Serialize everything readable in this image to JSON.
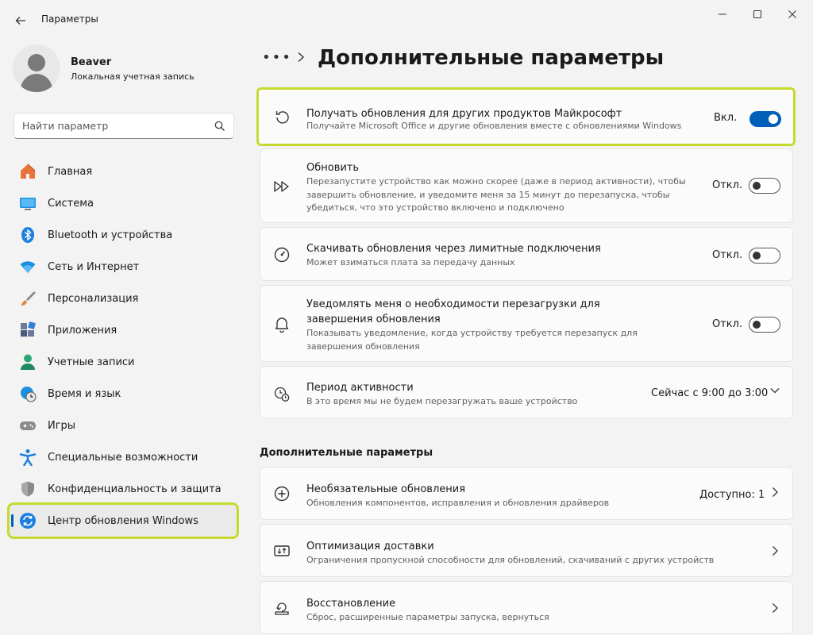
{
  "window": {
    "title": "Параметры",
    "back_icon": "back-arrow-icon",
    "minimize_icon": "minimize-icon",
    "maximize_icon": "maximize-icon",
    "close_icon": "close-icon"
  },
  "profile": {
    "name": "Beaver",
    "account_type": "Локальная учетная запись"
  },
  "search": {
    "placeholder": "Найти параметр"
  },
  "sidebar": {
    "items": [
      {
        "label": "Главная",
        "icon": "home-icon",
        "color": "#e8733a"
      },
      {
        "label": "Система",
        "icon": "monitor-icon",
        "color": "#1d8fe0"
      },
      {
        "label": "Bluetooth и устройства",
        "icon": "bluetooth-icon",
        "color": "#1d7fe0"
      },
      {
        "label": "Сеть и Интернет",
        "icon": "wifi-icon",
        "color": "#1d8fe0"
      },
      {
        "label": "Персонализация",
        "icon": "brush-icon",
        "color": "#e08a3a"
      },
      {
        "label": "Приложения",
        "icon": "apps-icon",
        "color": "#4a5a7a"
      },
      {
        "label": "Учетные записи",
        "icon": "account-icon",
        "color": "#2aa876"
      },
      {
        "label": "Время и язык",
        "icon": "globe-clock-icon",
        "color": "#1d8fe0"
      },
      {
        "label": "Игры",
        "icon": "gamepad-icon",
        "color": "#8a8a8a"
      },
      {
        "label": "Специальные возможности",
        "icon": "accessibility-icon",
        "color": "#1d7fe0"
      },
      {
        "label": "Конфиденциальность и защита",
        "icon": "shield-icon",
        "color": "#8a8a8a"
      },
      {
        "label": "Центр обновления Windows",
        "icon": "windows-update-icon",
        "color": "#1d7fe0"
      }
    ],
    "active_index": 11
  },
  "breadcrumb": {
    "overflow": "•••",
    "title": "Дополнительные параметры"
  },
  "settings": [
    {
      "title": "Получать обновления для других продуктов Майкрософт",
      "desc": "Получайте Microsoft Office и другие обновления вместе с обновлениями Windows",
      "state": "Вкл.",
      "on": true,
      "icon": "history-icon"
    },
    {
      "title": "Обновить",
      "desc": "Перезапустите устройство как можно скорее (даже в период активности), чтобы завершить обновление, и уведомите меня за 15 минут до перезапуска, чтобы убедиться, что это устройство включено и подключено",
      "state": "Откл.",
      "on": false,
      "icon": "fast-forward-icon"
    },
    {
      "title": "Скачивать обновления через лимитные подключения",
      "desc": "Может взиматься плата за передачу данных",
      "state": "Откл.",
      "on": false,
      "icon": "gauge-icon"
    },
    {
      "title": "Уведомлять меня о необходимости перезагрузки для завершения обновления",
      "desc": "Показывать уведомление, когда устройству требуется перезапуск для завершения обновления",
      "state": "Откл.",
      "on": false,
      "icon": "bell-icon"
    },
    {
      "title": "Период активности",
      "desc": "В это время мы не будем перезагружать ваше устройство",
      "value": "Сейчас с 9:00 до 3:00",
      "icon": "active-hours-icon"
    }
  ],
  "additional_section": {
    "title": "Дополнительные параметры",
    "items": [
      {
        "title": "Необязательные обновления",
        "desc": "Обновления компонентов, исправления и обновления драйверов",
        "value": "Доступно: 1",
        "icon": "plus-circle-icon"
      },
      {
        "title": "Оптимизация доставки",
        "desc": "Ограничения пропускной способности для обновлений, скачиваний с других устройств",
        "icon": "delivery-icon"
      },
      {
        "title": "Восстановление",
        "desc": "Сброс, расширенные параметры запуска, вернуться",
        "icon": "recovery-icon"
      }
    ]
  },
  "colors": {
    "accent": "#005fb8",
    "highlight": "#c6d92f"
  }
}
